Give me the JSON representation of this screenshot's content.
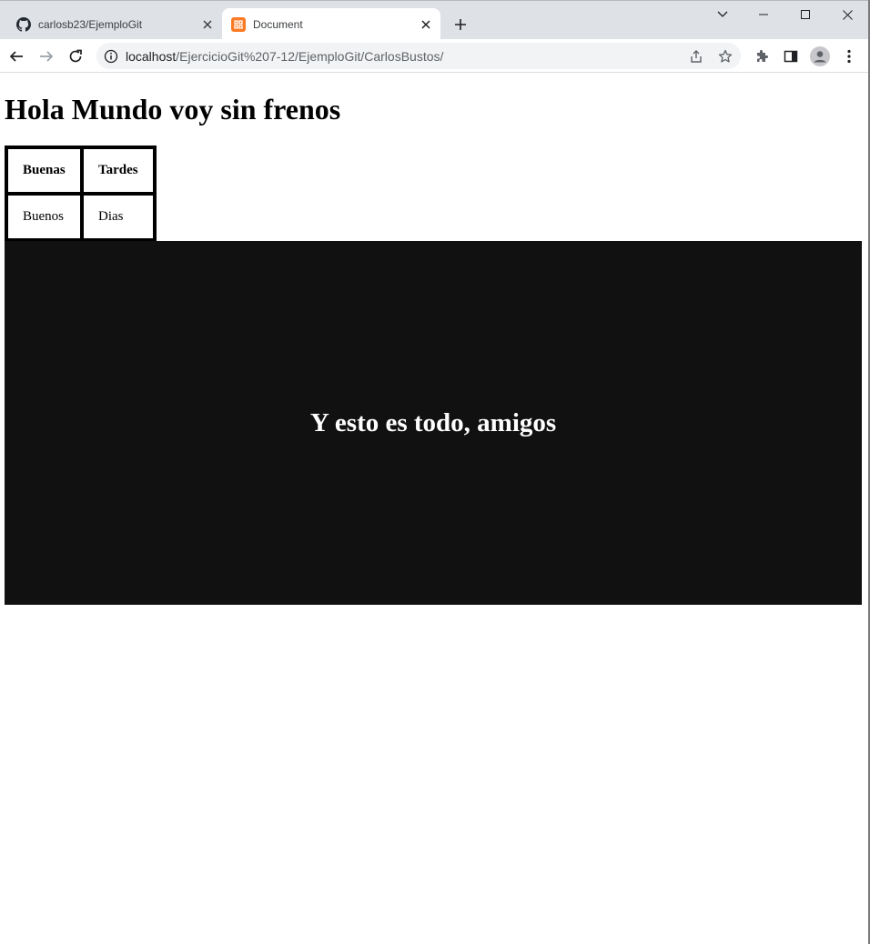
{
  "browser": {
    "tabs": [
      {
        "title": "carlosb23/EjemploGit",
        "icon": "github-icon",
        "active": false
      },
      {
        "title": "Document",
        "icon": "xampp-icon",
        "active": true
      }
    ],
    "address": {
      "host": "localhost",
      "path": "/EjercicioGit%207-12/EjemploGit/CarlosBustos/"
    },
    "colors": {
      "tabstrip": "#dee1e6",
      "omnibox": "#f1f3f4",
      "favicon_accent": "#fb7a24",
      "profile": "#c7c7cc"
    }
  },
  "page": {
    "heading": "Hola Mundo voy sin frenos",
    "table": {
      "headers": [
        "Buenas",
        "Tardes"
      ],
      "rows": [
        [
          "Buenos",
          "Dias"
        ]
      ]
    },
    "footer_text": "Y esto es todo, amigos",
    "colors": {
      "dark_box": "#111111",
      "footer_text": "#ffffff"
    }
  }
}
